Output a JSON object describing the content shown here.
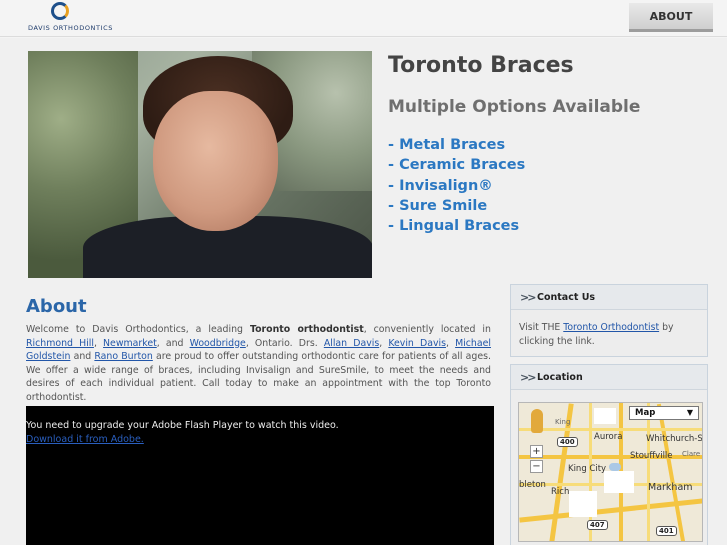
{
  "header": {
    "logo_text": "DAVIS ORTHODONTICS",
    "nav_about": "ABOUT"
  },
  "hero": {
    "title": "Toronto Braces",
    "subtitle": "Multiple Options Available",
    "options": [
      "- Metal Braces",
      "- Ceramic Braces",
      "- Invisalign®",
      "- Sure Smile",
      "- Lingual Braces"
    ]
  },
  "about": {
    "title": "About",
    "text": {
      "p1": "Welcome to Davis Orthodontics, a leading ",
      "bold": "Toronto orthodontist",
      "p2": ", conveniently located in ",
      "link_richmond": "Richmond Hill",
      "sep1": ", ",
      "link_newmarket": "Newmarket",
      "sep2": ", and ",
      "link_woodbridge": "Woodbridge",
      "p3": ", Ontario. Drs. ",
      "link_allan": "Allan Davis",
      "sep3": ", ",
      "link_kevin": "Kevin Davis",
      "sep4": ", ",
      "link_michael": "Michael Goldstein",
      "sep5": " and ",
      "link_rano": "Rano Burton",
      "p4": " are proud to offer outstanding orthodontic care for patients of all ages. We offer a wide range of braces, including Invisalign and SureSmile, to meet the needs and desires of each individual patient. Call today to make an appointment with the top Toronto orthodontist."
    }
  },
  "video": {
    "message": "You need to upgrade your Adobe Flash Player to watch this video.",
    "link": "Download it from Adobe."
  },
  "contact": {
    "title": "Contact Us",
    "text_before": "Visit THE ",
    "link": "Toronto Orthodontist",
    "text_after": " by clicking the link."
  },
  "location": {
    "title": "Location",
    "map_type": "Map",
    "labels": [
      "King",
      "Aurora",
      "Whitchurch-St",
      "Clare",
      "Stouffville",
      "King City",
      "Markham",
      "bleton",
      "Rich"
    ],
    "highways": [
      "400",
      "407",
      "401"
    ]
  }
}
